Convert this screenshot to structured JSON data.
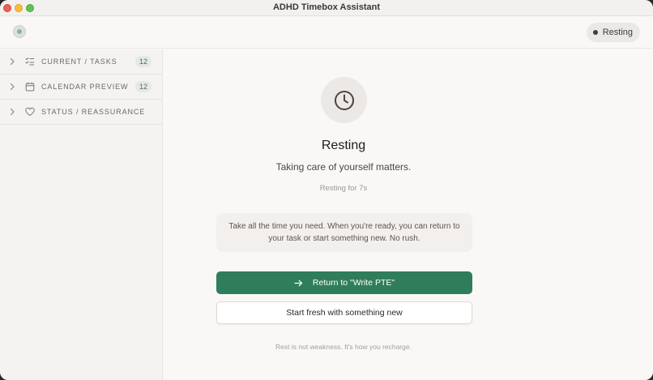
{
  "window": {
    "title": "ADHD Timebox Assistant"
  },
  "topbar": {
    "status_label": "Resting"
  },
  "sidebar": {
    "items": [
      {
        "label": "CURRENT / TASKS",
        "icon": "checklist-icon",
        "count": "12"
      },
      {
        "label": "CALENDAR PREVIEW",
        "icon": "calendar-icon",
        "count": "12"
      },
      {
        "label": "STATUS / REASSURANCE",
        "icon": "heart-icon"
      }
    ]
  },
  "main": {
    "icon": "clock-icon",
    "heading": "Resting",
    "subheading": "Taking care of yourself matters.",
    "timer": "Resting for 7s",
    "message": "Take all the time you need. When you're ready, you can return to your task or start something new. No rush.",
    "primary_button": "Return to \"Write PTE\"",
    "secondary_button": "Start fresh with something new",
    "footer": "Rest is not weakness. It's how you recharge."
  },
  "colors": {
    "accent": "#2f7d5b",
    "background": "#faf8f6",
    "sidebar": "#f5f3f1"
  }
}
